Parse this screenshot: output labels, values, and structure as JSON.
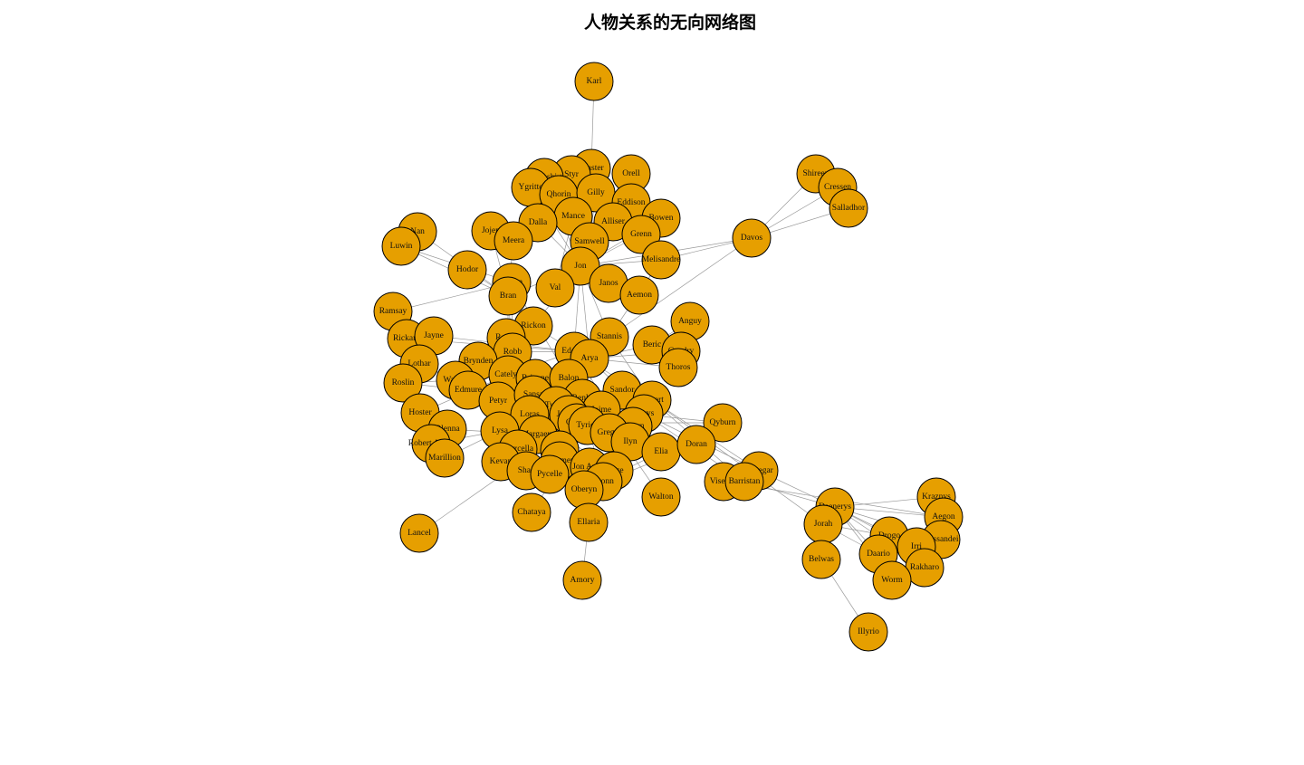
{
  "title": "人物关系的无向网络图",
  "colors": {
    "node_fill": "#E69F00",
    "node_stroke": "#000000",
    "edge": "#9a9a9a"
  },
  "nodes": [
    "Karl",
    "Shireen",
    "Cressen",
    "Salladhor",
    "Davos",
    "Orell",
    "Craster",
    "Styr",
    "Rattleshirt",
    "Ygritte",
    "Qhorin",
    "Gilly",
    "Eddison",
    "Bowen",
    "Mance",
    "Alliser",
    "Dalla",
    "Jojen",
    "Meera",
    "Samwell",
    "Grenn",
    "Melisandre",
    "Jon",
    "Nan",
    "Luwin",
    "Hodor",
    "Theon",
    "Bran",
    "Val",
    "Janos",
    "Aemon",
    "Anguy",
    "Ramsay",
    "Rickon",
    "Stannis",
    "Rickard",
    "Jayne",
    "Roose",
    "Robb",
    "Eddard",
    "Beric",
    "Gendry",
    "Brynden",
    "Arya",
    "Thoros",
    "Lothar",
    "Catelyn",
    "Brienne",
    "Balon",
    "Walder",
    "Edmure",
    "Roslin",
    "Sandor",
    "Petyr",
    "Sansa",
    "Renly",
    "Robert",
    "Tywin",
    "Jaime",
    "Hoster",
    "Loras",
    "Joffrey",
    "Aerys",
    "Olenna",
    "Cersei",
    "Qyburn",
    "Tyrion",
    "Margaery",
    "Meryn",
    "Lysa",
    "Gregor",
    "Robert Arryn",
    "Ilyn",
    "Elia",
    "Doran",
    "Marillion",
    "Myrcella",
    "Podrick",
    "Kevan",
    "Tommen",
    "Jon Arryn",
    "Rhaegar",
    "Mace",
    "Shae",
    "Pycelle",
    "Bronn",
    "Visenya",
    "Barristan",
    "Oberyn",
    "Daenerys",
    "Kraznys",
    "Walton",
    "Aegon",
    "Chataya",
    "Jorah",
    "Ellaria",
    "Drogo",
    "Missandei",
    "Daario",
    "Irri",
    "Rakharo",
    "Worm",
    "Lancel",
    "Belwas",
    "Amory",
    "Illyrio"
  ],
  "edges": [
    [
      "Karl",
      "Craster"
    ],
    [
      "Shireen",
      "Davos"
    ],
    [
      "Cressen",
      "Davos"
    ],
    [
      "Salladhor",
      "Davos"
    ],
    [
      "Shireen",
      "Salladhor"
    ],
    [
      "Cressen",
      "Salladhor"
    ],
    [
      "Davos",
      "Stannis"
    ],
    [
      "Davos",
      "Melisandre"
    ],
    [
      "Davos",
      "Jon"
    ],
    [
      "Orell",
      "Jon"
    ],
    [
      "Craster",
      "Jon"
    ],
    [
      "Styr",
      "Jon"
    ],
    [
      "Rattleshirt",
      "Jon"
    ],
    [
      "Ygritte",
      "Jon"
    ],
    [
      "Qhorin",
      "Jon"
    ],
    [
      "Gilly",
      "Samwell"
    ],
    [
      "Eddison",
      "Jon"
    ],
    [
      "Bowen",
      "Jon"
    ],
    [
      "Mance",
      "Jon"
    ],
    [
      "Alliser",
      "Jon"
    ],
    [
      "Dalla",
      "Jon"
    ],
    [
      "Samwell",
      "Jon"
    ],
    [
      "Grenn",
      "Jon"
    ],
    [
      "Melisandre",
      "Jon"
    ],
    [
      "Val",
      "Jon"
    ],
    [
      "Janos",
      "Jon"
    ],
    [
      "Aemon",
      "Jon"
    ],
    [
      "Jon",
      "Stannis"
    ],
    [
      "Jon",
      "Robb"
    ],
    [
      "Jon",
      "Eddard"
    ],
    [
      "Jon",
      "Arya"
    ],
    [
      "Jon",
      "Bran"
    ],
    [
      "Jojen",
      "Bran"
    ],
    [
      "Meera",
      "Bran"
    ],
    [
      "Nan",
      "Bran"
    ],
    [
      "Luwin",
      "Bran"
    ],
    [
      "Hodor",
      "Bran"
    ],
    [
      "Theon",
      "Bran"
    ],
    [
      "Jojen",
      "Meera"
    ],
    [
      "Luwin",
      "Theon"
    ],
    [
      "Bran",
      "Rickon"
    ],
    [
      "Bran",
      "Robb"
    ],
    [
      "Bran",
      "Catelyn"
    ],
    [
      "Theon",
      "Robb"
    ],
    [
      "Ramsay",
      "Theon"
    ],
    [
      "Rickard",
      "Eddard"
    ],
    [
      "Jayne",
      "Eddard"
    ],
    [
      "Roose",
      "Robb"
    ],
    [
      "Robb",
      "Catelyn"
    ],
    [
      "Robb",
      "Eddard"
    ],
    [
      "Robb",
      "Walder"
    ],
    [
      "Robb",
      "Edmure"
    ],
    [
      "Robb",
      "Brynden"
    ],
    [
      "Eddard",
      "Arya"
    ],
    [
      "Eddard",
      "Robert"
    ],
    [
      "Eddard",
      "Catelyn"
    ],
    [
      "Eddard",
      "Sansa"
    ],
    [
      "Arya",
      "Sandor"
    ],
    [
      "Arya",
      "Beric"
    ],
    [
      "Arya",
      "Gendry"
    ],
    [
      "Arya",
      "Thoros"
    ],
    [
      "Anguy",
      "Beric"
    ],
    [
      "Beric",
      "Thoros"
    ],
    [
      "Gendry",
      "Thoros"
    ],
    [
      "Lothar",
      "Walder"
    ],
    [
      "Walder",
      "Roslin"
    ],
    [
      "Edmure",
      "Roslin"
    ],
    [
      "Hoster",
      "Catelyn"
    ],
    [
      "Catelyn",
      "Brienne"
    ],
    [
      "Brienne",
      "Jaime"
    ],
    [
      "Balon",
      "Theon"
    ],
    [
      "Petyr",
      "Sansa"
    ],
    [
      "Petyr",
      "Lysa"
    ],
    [
      "Sansa",
      "Joffrey"
    ],
    [
      "Sansa",
      "Tyrion"
    ],
    [
      "Sansa",
      "Sandor"
    ],
    [
      "Renly",
      "Stannis"
    ],
    [
      "Renly",
      "Loras"
    ],
    [
      "Robert",
      "Stannis"
    ],
    [
      "Robert",
      "Cersei"
    ],
    [
      "Tywin",
      "Tyrion"
    ],
    [
      "Tywin",
      "Jaime"
    ],
    [
      "Tywin",
      "Cersei"
    ],
    [
      "Jaime",
      "Cersei"
    ],
    [
      "Joffrey",
      "Cersei"
    ],
    [
      "Joffrey",
      "Margaery"
    ],
    [
      "Olenna",
      "Margaery"
    ],
    [
      "Loras",
      "Margaery"
    ],
    [
      "Aerys",
      "Jaime"
    ],
    [
      "Qyburn",
      "Cersei"
    ],
    [
      "Tyrion",
      "Shae"
    ],
    [
      "Tyrion",
      "Bronn"
    ],
    [
      "Tyrion",
      "Podrick"
    ],
    [
      "Meryn",
      "Sansa"
    ],
    [
      "Lysa",
      "Robert Arryn"
    ],
    [
      "Lysa",
      "Marillion"
    ],
    [
      "Gregor",
      "Sandor"
    ],
    [
      "Ilyn",
      "Eddard"
    ],
    [
      "Elia",
      "Oberyn"
    ],
    [
      "Doran",
      "Oberyn"
    ],
    [
      "Myrcella",
      "Cersei"
    ],
    [
      "Kevan",
      "Tywin"
    ],
    [
      "Tommen",
      "Cersei"
    ],
    [
      "Jon Arryn",
      "Lysa"
    ],
    [
      "Rhaegar",
      "Aerys"
    ],
    [
      "Mace",
      "Loras"
    ],
    [
      "Pycelle",
      "Tywin"
    ],
    [
      "Oberyn",
      "Ellaria"
    ],
    [
      "Amory",
      "Ellaria"
    ],
    [
      "Chataya",
      "Tyrion"
    ],
    [
      "Lancel",
      "Cersei"
    ],
    [
      "Walton",
      "Jaime"
    ],
    [
      "Robert",
      "Rhaegar"
    ],
    [
      "Aerys",
      "Barristan"
    ],
    [
      "Robert",
      "Barristan"
    ],
    [
      "Visenya",
      "Aegon"
    ],
    [
      "Barristan",
      "Daenerys"
    ],
    [
      "Rhaegar",
      "Daenerys"
    ],
    [
      "Jorah",
      "Daenerys"
    ],
    [
      "Jorah",
      "Robert"
    ],
    [
      "Belwas",
      "Daenerys"
    ],
    [
      "Kraznys",
      "Daenerys"
    ],
    [
      "Aegon",
      "Daenerys"
    ],
    [
      "Drogo",
      "Daenerys"
    ],
    [
      "Missandei",
      "Daenerys"
    ],
    [
      "Daario",
      "Daenerys"
    ],
    [
      "Irri",
      "Daenerys"
    ],
    [
      "Rakharo",
      "Daenerys"
    ],
    [
      "Worm",
      "Daenerys"
    ],
    [
      "Illyrio",
      "Belwas"
    ],
    [
      "Drogo",
      "Jorah"
    ],
    [
      "Missandei",
      "Worm"
    ],
    [
      "Daario",
      "Jorah"
    ],
    [
      "Qyburn",
      "Jaime"
    ],
    [
      "Doran",
      "Elia"
    ],
    [
      "Stannis",
      "Melisandre"
    ],
    [
      "Val",
      "Mance"
    ],
    [
      "Rickon",
      "Eddard"
    ],
    [
      "Janos",
      "Aemon"
    ]
  ]
}
